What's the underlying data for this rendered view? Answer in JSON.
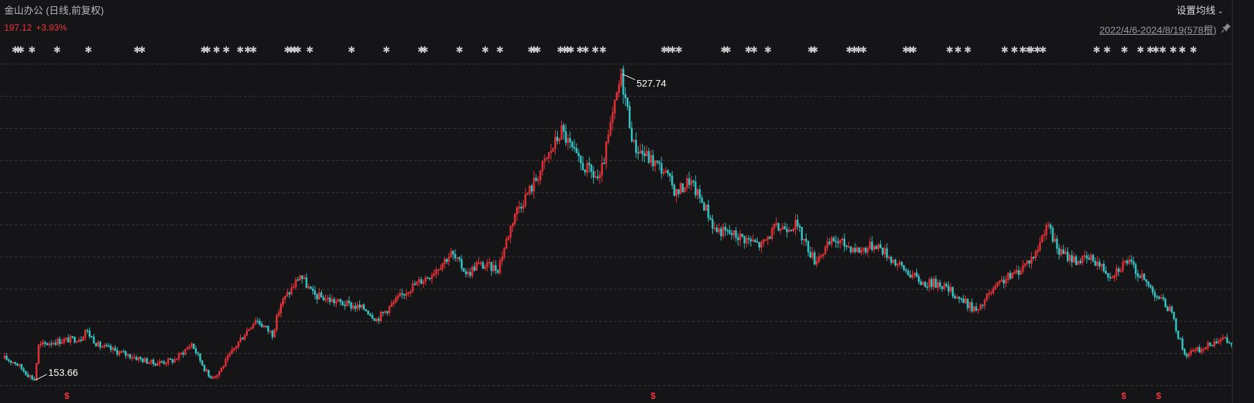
{
  "header": {
    "title": "金山办公 (日线,前复权)",
    "price": "197.12",
    "change": "+3.93%",
    "ma_setting": "设置均线",
    "range": "2022/4/6-2024/8/19(578根)"
  },
  "icons": {
    "pin": "pin-icon",
    "dropdown": "chevron-down-icon",
    "event": "event-marker-icon",
    "signal": "s-signal-icon"
  },
  "colors": {
    "up": "#f0343a",
    "down": "#36c2c2",
    "background": "#151517",
    "grid": "#3a3a3a",
    "text": "#cfcfcf"
  },
  "chart_data": {
    "type": "candlestick",
    "title": "金山办公 (日线,前复权)",
    "period": "2022/4/6-2024/8/19",
    "bars": 578,
    "ylim": [
      145,
      535
    ],
    "grid": "horizontal-dashed",
    "annotations": {
      "high": {
        "label": "527.74",
        "value": 527.74,
        "index": 290
      },
      "low": {
        "label": "153.66",
        "value": 153.66,
        "index": 14
      }
    },
    "key_levels": [
      [
        0,
        180
      ],
      [
        5,
        175
      ],
      [
        12,
        158
      ],
      [
        14,
        154
      ],
      [
        16,
        195
      ],
      [
        22,
        200
      ],
      [
        36,
        205
      ],
      [
        38,
        215
      ],
      [
        44,
        196
      ],
      [
        70,
        174
      ],
      [
        80,
        178
      ],
      [
        88,
        198
      ],
      [
        96,
        158
      ],
      [
        100,
        160
      ],
      [
        110,
        200
      ],
      [
        118,
        228
      ],
      [
        126,
        210
      ],
      [
        130,
        247
      ],
      [
        135,
        265
      ],
      [
        139,
        282
      ],
      [
        145,
        258
      ],
      [
        155,
        250
      ],
      [
        170,
        240
      ],
      [
        175,
        228
      ],
      [
        190,
        265
      ],
      [
        200,
        282
      ],
      [
        210,
        308
      ],
      [
        218,
        283
      ],
      [
        222,
        295
      ],
      [
        232,
        290
      ],
      [
        240,
        358
      ],
      [
        248,
        390
      ],
      [
        262,
        459
      ],
      [
        270,
        420
      ],
      [
        280,
        398
      ],
      [
        290,
        527
      ],
      [
        296,
        440
      ],
      [
        310,
        410
      ],
      [
        316,
        382
      ],
      [
        322,
        398
      ],
      [
        330,
        363
      ],
      [
        334,
        338
      ],
      [
        345,
        330
      ],
      [
        356,
        318
      ],
      [
        362,
        338
      ],
      [
        372,
        344
      ],
      [
        381,
        300
      ],
      [
        390,
        325
      ],
      [
        402,
        312
      ],
      [
        410,
        320
      ],
      [
        420,
        295
      ],
      [
        432,
        272
      ],
      [
        440,
        272
      ],
      [
        452,
        248
      ],
      [
        458,
        237
      ],
      [
        462,
        255
      ],
      [
        470,
        276
      ],
      [
        475,
        283
      ],
      [
        485,
        308
      ],
      [
        490,
        345
      ],
      [
        496,
        310
      ],
      [
        504,
        300
      ],
      [
        512,
        302
      ],
      [
        520,
        282
      ],
      [
        528,
        300
      ],
      [
        536,
        275
      ],
      [
        548,
        240
      ],
      [
        555,
        185
      ],
      [
        564,
        192
      ],
      [
        572,
        206
      ],
      [
        577,
        197
      ]
    ]
  }
}
